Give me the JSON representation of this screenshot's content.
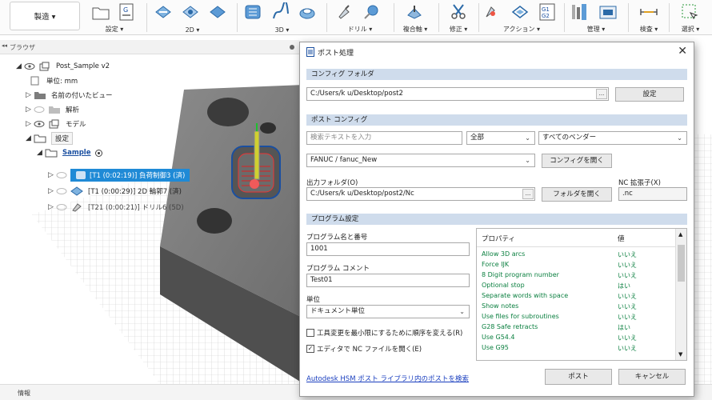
{
  "toolbar": {
    "workspace": "製造 ▾",
    "groups": [
      {
        "label": "設定 ▾"
      },
      {
        "label": "2D ▾"
      },
      {
        "label": "3D ▾"
      },
      {
        "label": "ドリル ▾"
      },
      {
        "label": "複合軸 ▾"
      },
      {
        "label": "修正 ▾"
      },
      {
        "label": "アクション ▾"
      },
      {
        "label": "管理 ▾"
      },
      {
        "label": "検査 ▾"
      },
      {
        "label": "選択 ▾"
      }
    ],
    "g1g2_icon_text": "G1 G2"
  },
  "browser": {
    "title": "ブラウザ",
    "items": [
      {
        "label": "Post_Sample v2"
      },
      {
        "label": "単位: mm"
      },
      {
        "label": "名前の付いたビュー"
      },
      {
        "label": "解析"
      },
      {
        "label": "モデル"
      },
      {
        "label": "設定"
      },
      {
        "label": "Sample"
      },
      {
        "label": "[T1 (0:02:19)] 負荷制御3 (済)"
      },
      {
        "label": "[T1 (0:00:29)] 2D 輪郭7 (済)"
      },
      {
        "label": "[T21 (0:00:21)] ドリル6 (5D)"
      }
    ]
  },
  "footer": {
    "label": "情報"
  },
  "dialog": {
    "title": "ポスト処理",
    "config_folder": {
      "header": "コンフィグ フォルダ",
      "path": "C:/Users/k   u/Desktop/post2",
      "settings_btn": "設定"
    },
    "post_config": {
      "header": "ポスト コンフィグ",
      "search_placeholder": "検索テキストを入力",
      "filter_all": "全部",
      "vendor": "すべてのベンダー",
      "config": "FANUC / fanuc_New",
      "open_config_btn": "コンフィグを開く",
      "output_folder_label": "出力フォルダ(O)",
      "output_folder": "C:/Users/k   u/Desktop/post2/Nc",
      "open_folder_btn": "フォルダを開く",
      "nc_ext_label": "NC 拡張子(X)",
      "nc_ext": ".nc"
    },
    "program": {
      "header": "プログラム設定",
      "name_label": "プログラム名と番号",
      "name_value": "1001",
      "comment_label": "プログラム コメント",
      "comment_value": "Test01",
      "unit_label": "単位",
      "unit_value": "ドキュメント単位",
      "reorder_label": "工具変更を最小限にするために順序を変える(R)",
      "reorder_checked": false,
      "open_editor_label": "エディタで NC ファイルを開く(E)",
      "open_editor_checked": true
    },
    "properties": {
      "col_property": "プロパティ",
      "col_value": "値",
      "rows": [
        {
          "name": "Allow 3D arcs",
          "value": "いいえ"
        },
        {
          "name": "Force IJK",
          "value": "いいえ"
        },
        {
          "name": "8 Digit program number",
          "value": "いいえ"
        },
        {
          "name": "Optional stop",
          "value": "はい"
        },
        {
          "name": "Separate words with space",
          "value": "いいえ"
        },
        {
          "name": "Show notes",
          "value": "いいえ"
        },
        {
          "name": "Use files for subroutines",
          "value": "いいえ"
        },
        {
          "name": "G28 Safe retracts",
          "value": "はい"
        },
        {
          "name": "Use G54.4",
          "value": "いいえ"
        },
        {
          "name": "Use G95",
          "value": "いいえ"
        }
      ]
    },
    "help_link": "Autodesk HSM ポスト ライブラリ内のポストを検索",
    "post_btn": "ポスト",
    "cancel_btn": "キャンセル"
  }
}
